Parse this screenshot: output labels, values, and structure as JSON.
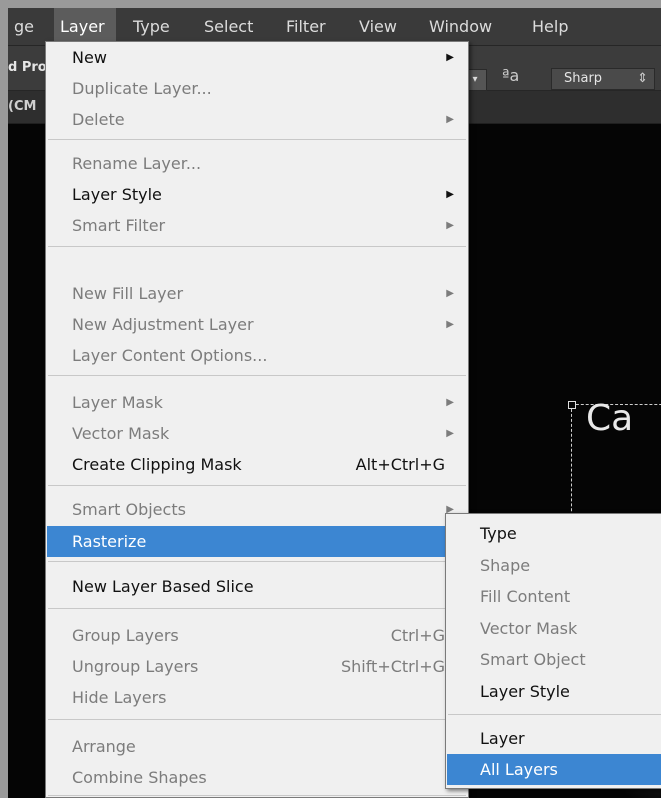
{
  "menubar": {
    "items": [
      "ge",
      "Layer",
      "Type",
      "Select",
      "Filter",
      "View",
      "Window",
      "Help"
    ]
  },
  "options_bar": {
    "truncated_label": "d Pro",
    "antialias_icon": "aa-icon",
    "antialias_glyph": "ªa",
    "antialias_value": "Sharp",
    "dropdown_glyph": "▾",
    "stepper_glyph": "⇕"
  },
  "doc_tab": {
    "label": "(CM"
  },
  "canvas": {
    "text": "Ca"
  },
  "layer_menu": {
    "items": [
      {
        "label": "New",
        "enabled": true,
        "submenu": true
      },
      {
        "label": "Duplicate Layer...",
        "enabled": false
      },
      {
        "label": "Delete",
        "enabled": false,
        "submenu": true
      },
      {
        "label": "Rename Layer...",
        "enabled": false
      },
      {
        "label": "Layer Style",
        "enabled": true,
        "submenu": true
      },
      {
        "label": "Smart Filter",
        "enabled": false,
        "submenu": true
      },
      {
        "label": "New Fill Layer",
        "enabled": false,
        "submenu": true
      },
      {
        "label": "New Adjustment Layer",
        "enabled": false,
        "submenu": true
      },
      {
        "label": "Layer Content Options...",
        "enabled": false
      },
      {
        "label": "Layer Mask",
        "enabled": false,
        "submenu": true
      },
      {
        "label": "Vector Mask",
        "enabled": false,
        "submenu": true
      },
      {
        "label": "Create Clipping Mask",
        "enabled": true,
        "shortcut": "Alt+Ctrl+G"
      },
      {
        "label": "Smart Objects",
        "enabled": false,
        "submenu": true
      },
      {
        "label": "Rasterize",
        "enabled": true,
        "submenu": true,
        "highlighted": true
      },
      {
        "label": "New Layer Based Slice",
        "enabled": true
      },
      {
        "label": "Group Layers",
        "enabled": false,
        "shortcut": "Ctrl+G"
      },
      {
        "label": "Ungroup Layers",
        "enabled": false,
        "shortcut": "Shift+Ctrl+G"
      },
      {
        "label": "Hide Layers",
        "enabled": false
      },
      {
        "label": "Arrange",
        "enabled": false,
        "submenu": true
      },
      {
        "label": "Combine Shapes",
        "enabled": false,
        "submenu": true
      }
    ]
  },
  "rasterize_menu": {
    "items": [
      {
        "label": "Type",
        "enabled": true
      },
      {
        "label": "Shape",
        "enabled": false
      },
      {
        "label": "Fill Content",
        "enabled": false
      },
      {
        "label": "Vector Mask",
        "enabled": false
      },
      {
        "label": "Smart Object",
        "enabled": false
      },
      {
        "label": "Layer Style",
        "enabled": true
      },
      {
        "label": "Layer",
        "enabled": true
      },
      {
        "label": "All Layers",
        "enabled": true,
        "highlighted": true
      }
    ]
  },
  "colors": {
    "highlight": "#3c86d2",
    "menu_bg": "#f0f0f0",
    "disabled_text": "#7c7c7c",
    "ui_dark": "#3a3a3a"
  }
}
